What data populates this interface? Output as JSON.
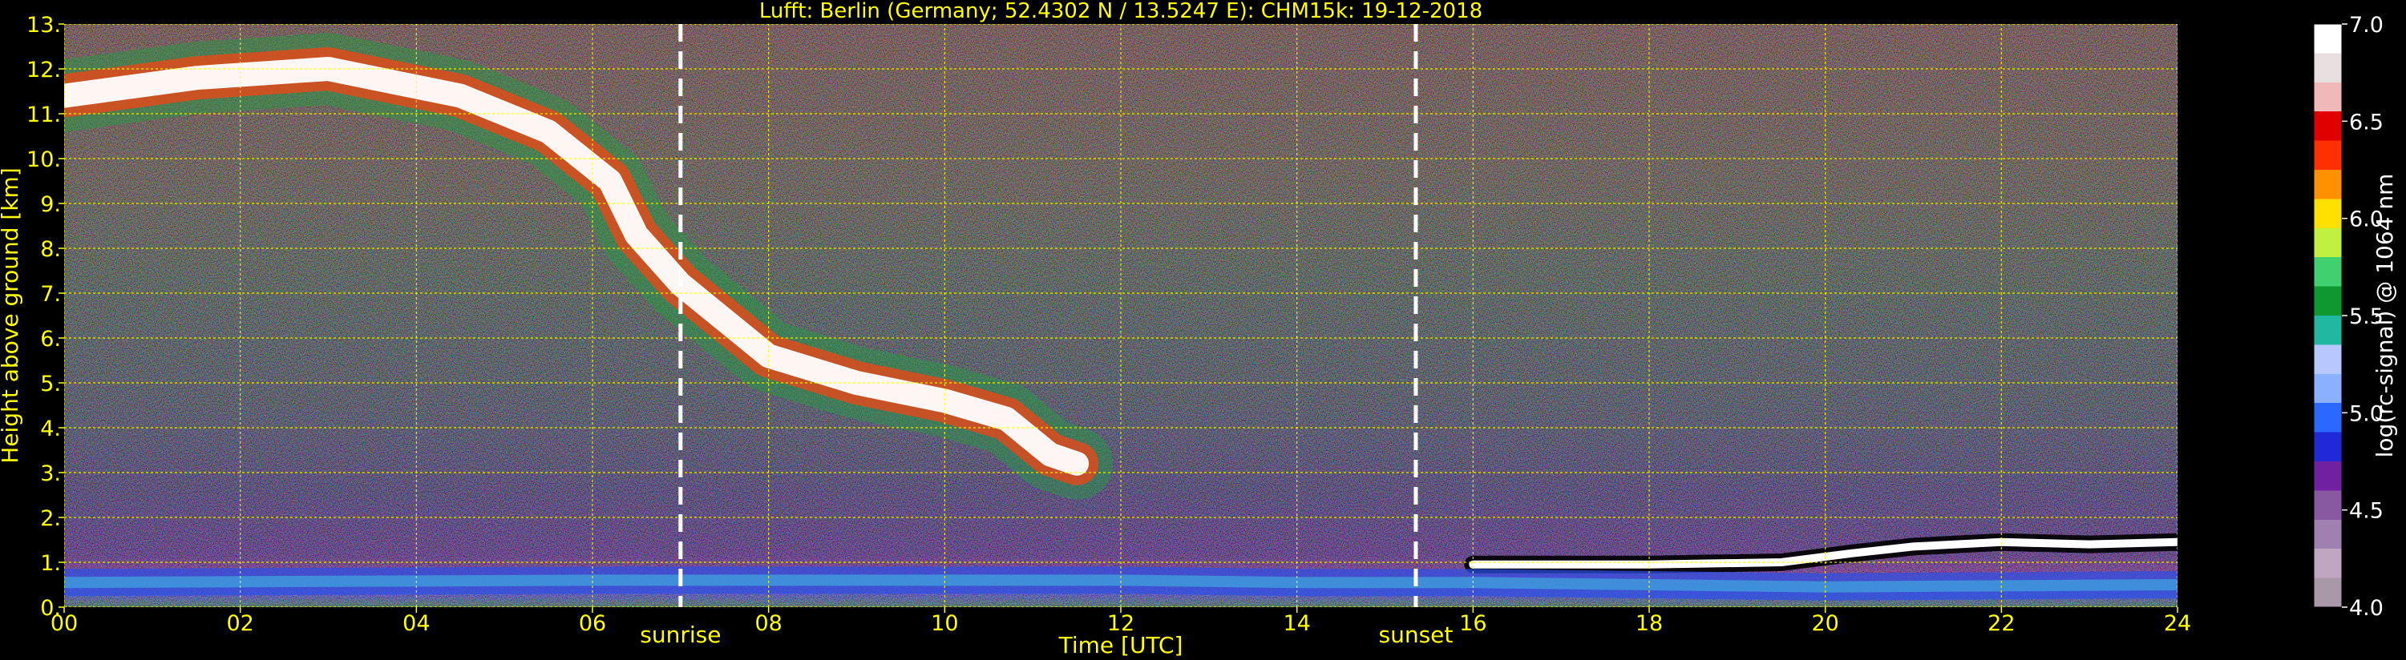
{
  "chart_data": {
    "type": "heatmap",
    "title": "Lufft: Berlin (Germany; 52.4302 N / 13.5247 E):    CHM15k: 19-12-2018",
    "xlabel": "Time [UTC]",
    "ylabel": "Height above ground [km]",
    "xlim": [
      0,
      24
    ],
    "ylim": [
      0,
      13
    ],
    "x_tick_labels": [
      "00",
      "02",
      "04",
      "06",
      "08",
      "10",
      "12",
      "14",
      "16",
      "18",
      "20",
      "22",
      "24"
    ],
    "y_tick_labels": [
      "0.",
      "1.",
      "2.",
      "3.",
      "4.",
      "5.",
      "6.",
      "7.",
      "8.",
      "9.",
      "10.",
      "11.",
      "12.",
      "13."
    ],
    "grid": true,
    "annotations": [
      {
        "label": "sunrise",
        "x": 7.0
      },
      {
        "label": "sunset",
        "x": 15.35
      }
    ],
    "colorbar": {
      "label": "log(rc-signal) @ 1064 nm",
      "range": [
        4.0,
        7.0
      ],
      "tick_labels": [
        "4.0",
        "4.5",
        "5.0",
        "5.5",
        "6.0",
        "6.5",
        "7.0"
      ]
    },
    "features": [
      {
        "name": "cirrus layer",
        "points": [
          [
            0,
            11.4
          ],
          [
            1.5,
            11.8
          ],
          [
            3,
            12.0
          ],
          [
            4.5,
            11.4
          ],
          [
            5.5,
            10.6
          ],
          [
            6.2,
            9.5
          ],
          [
            6.5,
            8.3
          ],
          [
            7,
            7.2
          ],
          [
            8,
            5.6
          ],
          [
            9,
            5.0
          ],
          [
            10,
            4.6
          ],
          [
            10.7,
            4.2
          ],
          [
            11.2,
            3.4
          ],
          [
            11.5,
            3.2
          ]
        ]
      },
      {
        "name": "low cloud",
        "points": [
          [
            16,
            0.95
          ],
          [
            18,
            0.95
          ],
          [
            19.5,
            1.0
          ],
          [
            20.3,
            1.2
          ],
          [
            21,
            1.35
          ],
          [
            22,
            1.45
          ],
          [
            23,
            1.4
          ],
          [
            24,
            1.45
          ]
        ]
      },
      {
        "name": "boundary layer",
        "points": [
          [
            0,
            0.55
          ],
          [
            6,
            0.6
          ],
          [
            12,
            0.6
          ],
          [
            14,
            0.55
          ],
          [
            16,
            0.55
          ],
          [
            20,
            0.45
          ],
          [
            24,
            0.5
          ]
        ]
      }
    ]
  },
  "colors": {
    "text": "#ffff00",
    "grid": "#ffff00",
    "background": "#000000",
    "colormap": [
      "#a898a8",
      "#c0a6c0",
      "#a080b0",
      "#8858a0",
      "#7020a0",
      "#2028d8",
      "#2a68ff",
      "#8ab0ff",
      "#b8c8ff",
      "#20b8a0",
      "#109830",
      "#40d070",
      "#c0f040",
      "#ffe000",
      "#ff9000",
      "#ff3000",
      "#e00000",
      "#f0b8b8",
      "#e8e0e0",
      "#ffffff"
    ]
  }
}
